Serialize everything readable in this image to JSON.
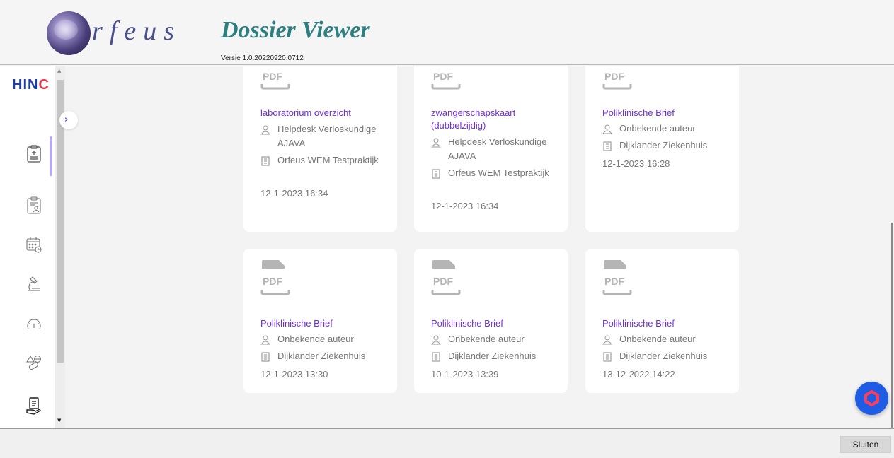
{
  "header": {
    "logo_text": "rfeus",
    "app_title": "Dossier Viewer",
    "version": "Versie 1.0.20220920.0712"
  },
  "sidebar": {
    "brand": "HIN",
    "brand_accent": "C",
    "nav_items": [
      {
        "icon": "clipboard-icon",
        "active": true
      },
      {
        "icon": "patient-record-icon",
        "active": false
      },
      {
        "icon": "calendar-clock-icon",
        "active": false
      },
      {
        "icon": "lab-flask-icon",
        "active": false
      },
      {
        "icon": "gauge-icon",
        "active": false
      },
      {
        "icon": "medication-icon",
        "active": false
      },
      {
        "icon": "document-hand-icon",
        "active": false
      }
    ],
    "collapse_icon": "chevron-right-icon"
  },
  "documents": [
    {
      "file_type": "PDF",
      "title": "laboratorium overzicht",
      "author": "Helpdesk Verloskundige AJAVA",
      "organization": "Orfeus WEM Testpraktijk",
      "date": "12-1-2023 16:34"
    },
    {
      "file_type": "PDF",
      "title": "zwangerschapskaart (dubbelzijdig)",
      "author": "Helpdesk Verloskundige AJAVA",
      "organization": "Orfeus WEM Testpraktijk",
      "date": "12-1-2023 16:34"
    },
    {
      "file_type": "PDF",
      "title": "Poliklinische Brief",
      "author": "Onbekende auteur",
      "organization": "Dijklander Ziekenhuis",
      "date": "12-1-2023 16:28"
    },
    {
      "file_type": "PDF",
      "title": "Poliklinische Brief",
      "author": "Onbekende auteur",
      "organization": "Dijklander Ziekenhuis",
      "date": "12-1-2023 13:30"
    },
    {
      "file_type": "PDF",
      "title": "Poliklinische Brief",
      "author": "Onbekende auteur",
      "organization": "Dijklander Ziekenhuis",
      "date": "10-1-2023 13:39"
    },
    {
      "file_type": "PDF",
      "title": "Poliklinische Brief",
      "author": "Onbekende auteur",
      "organization": "Dijklander Ziekenhuis",
      "date": "13-12-2022 14:22"
    }
  ],
  "fab": {
    "icon": "hinc-logo-icon"
  },
  "footer": {
    "close_label": "Sluiten"
  },
  "colors": {
    "accent": "#6f2fe0",
    "brand_blue": "#1d3fa8",
    "brand_red": "#e8384f",
    "title_teal": "#2e7f7f",
    "fab_blue": "#1e5ce6"
  }
}
